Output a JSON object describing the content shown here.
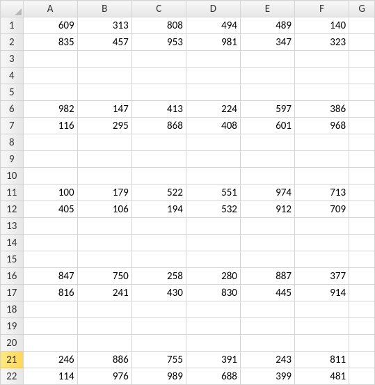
{
  "columns": [
    "A",
    "B",
    "C",
    "D",
    "E",
    "F",
    "G"
  ],
  "active_row": 21,
  "chart_data": {
    "type": "table",
    "rows": [
      {
        "row": 1,
        "A": 609,
        "B": 313,
        "C": 808,
        "D": 494,
        "E": 489,
        "F": 140
      },
      {
        "row": 2,
        "A": 835,
        "B": 457,
        "C": 953,
        "D": 981,
        "E": 347,
        "F": 323
      },
      {
        "row": 3
      },
      {
        "row": 4
      },
      {
        "row": 5
      },
      {
        "row": 6,
        "A": 982,
        "B": 147,
        "C": 413,
        "D": 224,
        "E": 597,
        "F": 386
      },
      {
        "row": 7,
        "A": 116,
        "B": 295,
        "C": 868,
        "D": 408,
        "E": 601,
        "F": 968
      },
      {
        "row": 8
      },
      {
        "row": 9
      },
      {
        "row": 10
      },
      {
        "row": 11,
        "A": 100,
        "B": 179,
        "C": 522,
        "D": 551,
        "E": 974,
        "F": 713
      },
      {
        "row": 12,
        "A": 405,
        "B": 106,
        "C": 194,
        "D": 532,
        "E": 912,
        "F": 709
      },
      {
        "row": 13
      },
      {
        "row": 14
      },
      {
        "row": 15
      },
      {
        "row": 16,
        "A": 847,
        "B": 750,
        "C": 258,
        "D": 280,
        "E": 887,
        "F": 377
      },
      {
        "row": 17,
        "A": 816,
        "B": 241,
        "C": 430,
        "D": 830,
        "E": 445,
        "F": 914
      },
      {
        "row": 18
      },
      {
        "row": 19
      },
      {
        "row": 20
      },
      {
        "row": 21,
        "A": 246,
        "B": 886,
        "C": 755,
        "D": 391,
        "E": 243,
        "F": 811
      },
      {
        "row": 22,
        "A": 114,
        "B": 976,
        "C": 989,
        "D": 688,
        "E": 399,
        "F": 481
      }
    ]
  }
}
